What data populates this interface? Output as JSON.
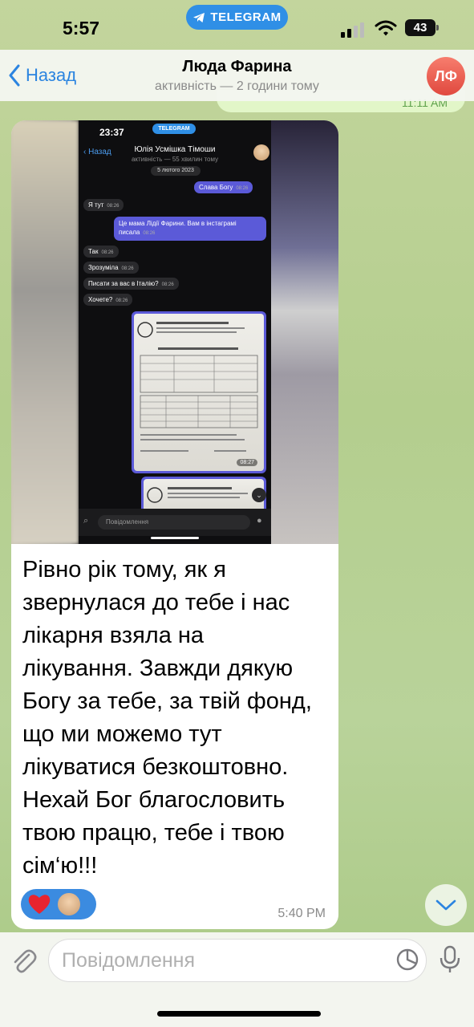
{
  "status_bar": {
    "time": "5:57",
    "app_pill": "TELEGRAM",
    "battery": "43"
  },
  "header": {
    "back_label": "Назад",
    "title": "Люда Фарина",
    "subtitle": "активність — 2 години тому",
    "avatar_initials": "ЛФ"
  },
  "previous_message": {
    "time": "11:11 AM"
  },
  "screenshot": {
    "time": "23:37",
    "pill": "TELEGRAM",
    "back": "Назад",
    "name": "Юлія Усмішка Тімоши",
    "sub": "активність — 55 хвилин тому",
    "date": "5 лютого 2023",
    "messages": [
      {
        "dir": "out",
        "text": "Слава Богу",
        "time": "08:26"
      },
      {
        "dir": "in",
        "text": "Я тут",
        "time": "08:26"
      },
      {
        "dir": "out",
        "text": "Це мама Лідії Фарини. Вам в інстаграмі писала",
        "time": "08:26"
      },
      {
        "dir": "in",
        "text": "Так",
        "time": "08:26"
      },
      {
        "dir": "in",
        "text": "Зрозуміла",
        "time": "08:26"
      },
      {
        "dir": "in",
        "text": "Писати за вас в Італію?",
        "time": "08:26"
      },
      {
        "dir": "in",
        "text": "Хочете?",
        "time": "08:26"
      }
    ],
    "doc_time": "08:27",
    "input_placeholder": "Повідомлення"
  },
  "message": {
    "text": "Рівно рік тому, як я\nзвернулася до тебе і  нас\nлікарня взяла на\nлікування. Завжди дякую\nБогу за тебе, за твій фонд,\nщо ми можемо тут\nлікуватися безкоштовно.\nНехай Бог благословить\nтвою працю, тебе і твою\nсім‘ю!!!",
    "time": "5:40 PM",
    "reaction": "heart"
  },
  "composer": {
    "placeholder": "Повідомлення"
  },
  "colors": {
    "accent": "#2b84e0",
    "avatar": "#ee5d4f",
    "bubble_in": "#ffffff",
    "bubble_out": "#e2f6c8",
    "chat_bg": "#b9cf94"
  }
}
